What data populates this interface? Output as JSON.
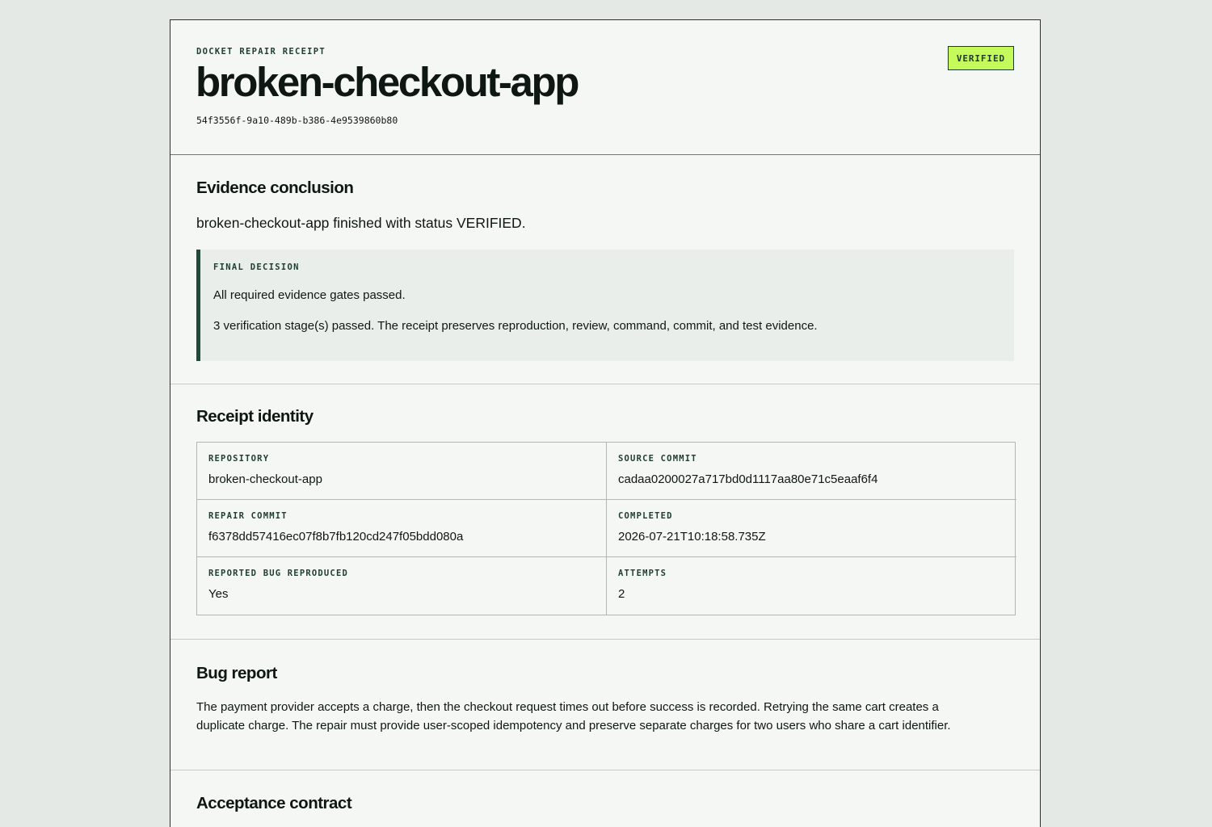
{
  "header": {
    "eyebrow": "DOCKET REPAIR RECEIPT",
    "title": "broken-checkout-app",
    "run_id": "54f3556f-9a10-489b-b386-4e9539860b80",
    "status_badge": "VERIFIED",
    "badge_color": "#c4fa5a"
  },
  "conclusion": {
    "heading": "Evidence conclusion",
    "summary": "broken-checkout-app finished with status VERIFIED.",
    "decision_label": "FINAL DECISION",
    "decision_line1": "All required evidence gates passed.",
    "decision_line2": "3 verification stage(s) passed. The receipt preserves reproduction, review, command, commit, and test evidence."
  },
  "identity": {
    "heading": "Receipt identity",
    "fields": [
      {
        "label": "REPOSITORY",
        "value": "broken-checkout-app"
      },
      {
        "label": "SOURCE COMMIT",
        "value": "cadaa0200027a717bd0d1117aa80e71c5eaaf6f4"
      },
      {
        "label": "REPAIR COMMIT",
        "value": "f6378dd57416ec07f8b7fb120cd247f05bdd080a"
      },
      {
        "label": "COMPLETED",
        "value": "2026-07-21T10:18:58.735Z"
      },
      {
        "label": "REPORTED BUG REPRODUCED",
        "value": "Yes"
      },
      {
        "label": "ATTEMPTS",
        "value": "2"
      }
    ]
  },
  "bug_report": {
    "heading": "Bug report",
    "text": "The payment provider accepts a charge, then the checkout request times out before success is recorded. Retrying the same cart creates a duplicate charge. The repair must provide user-scoped idempotency and preserve separate charges for two users who share a cart identifier."
  },
  "acceptance": {
    "heading": "Acceptance contract"
  }
}
